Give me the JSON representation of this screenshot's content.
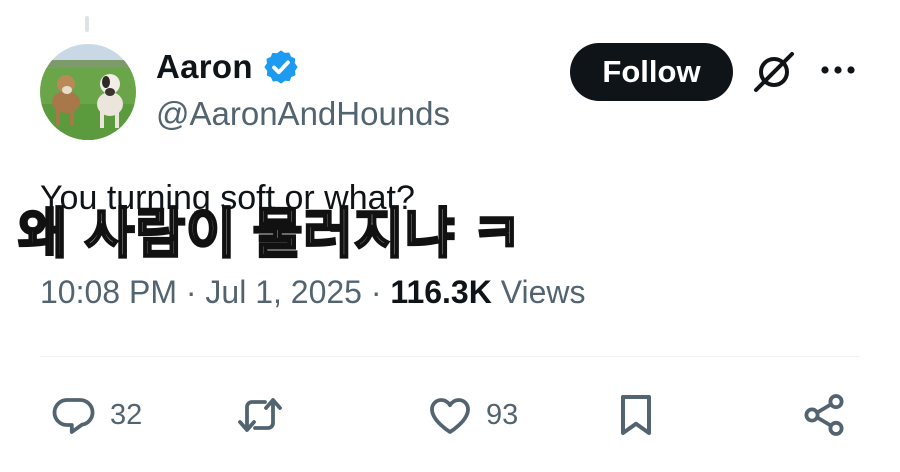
{
  "author": {
    "name": "Aaron",
    "handle": "@AaronAndHounds",
    "verified": true
  },
  "header": {
    "follow_label": "Follow",
    "grok_icon": "grok-icon",
    "more_icon": "more-icon"
  },
  "tweet": {
    "text": "You turning soft or what?",
    "caption": "왜 사람이 물러지냐 ㅋ"
  },
  "meta": {
    "time": "10:08 PM",
    "separator": " · ",
    "date": "Jul 1, 2025",
    "views_count": "116.3K",
    "views_label": " Views"
  },
  "actions": {
    "replies": "32",
    "retweets": "",
    "likes": "93"
  },
  "colors": {
    "verified_blue": "#1d9bf0",
    "secondary_text": "#536471",
    "primary_text": "#0f1419",
    "button_bg": "#0f1419"
  }
}
